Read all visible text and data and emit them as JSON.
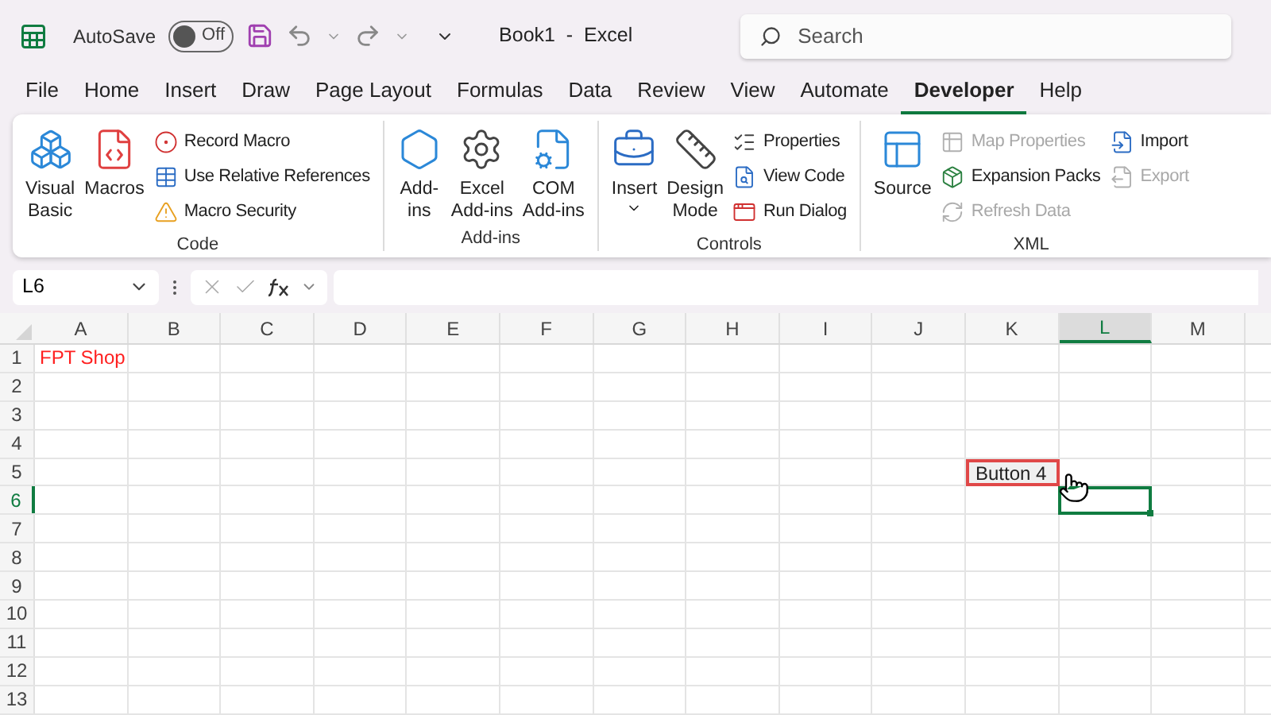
{
  "title_bar": {
    "autosave_label": "AutoSave",
    "autosave": {
      "on": false,
      "label": "Off"
    },
    "document_title": "Book1  -  Excel",
    "search": {
      "placeholder": "Search"
    }
  },
  "tabs": [
    {
      "label": "File",
      "selected": false
    },
    {
      "label": "Home",
      "selected": false
    },
    {
      "label": "Insert",
      "selected": false
    },
    {
      "label": "Draw",
      "selected": false
    },
    {
      "label": "Page Layout",
      "selected": false
    },
    {
      "label": "Formulas",
      "selected": false
    },
    {
      "label": "Data",
      "selected": false
    },
    {
      "label": "Review",
      "selected": false
    },
    {
      "label": "View",
      "selected": false
    },
    {
      "label": "Automate",
      "selected": false
    },
    {
      "label": "Developer",
      "selected": true
    },
    {
      "label": "Help",
      "selected": false
    }
  ],
  "ribbon": {
    "groups": [
      {
        "label": "Code",
        "items": [
          {
            "kind": "large",
            "lines": [
              "Visual",
              "Basic"
            ],
            "disabled": false
          },
          {
            "kind": "large",
            "lines": [
              "Macros"
            ],
            "disabled": false
          },
          {
            "kind": "small",
            "label": "Record Macro",
            "disabled": false
          },
          {
            "kind": "small",
            "label": "Use Relative References",
            "disabled": false
          },
          {
            "kind": "small",
            "label": "Macro Security",
            "disabled": false
          }
        ]
      },
      {
        "label": "Add-ins",
        "items": [
          {
            "kind": "large",
            "lines": [
              "Add-",
              "ins"
            ],
            "disabled": false
          },
          {
            "kind": "large",
            "lines": [
              "Excel",
              "Add-ins"
            ],
            "disabled": false
          },
          {
            "kind": "large",
            "lines": [
              "COM",
              "Add-ins"
            ],
            "disabled": false
          }
        ]
      },
      {
        "label": "Controls",
        "items": [
          {
            "kind": "large",
            "lines": [
              "Insert"
            ],
            "dropdown": true,
            "disabled": false
          },
          {
            "kind": "large",
            "lines": [
              "Design",
              "Mode"
            ],
            "disabled": false
          },
          {
            "kind": "small",
            "label": "Properties",
            "disabled": false
          },
          {
            "kind": "small",
            "label": "View Code",
            "disabled": false
          },
          {
            "kind": "small",
            "label": "Run Dialog",
            "disabled": false
          }
        ]
      },
      {
        "label": "XML",
        "items": [
          {
            "kind": "large",
            "lines": [
              "Source"
            ],
            "disabled": false
          },
          {
            "kind": "small",
            "label": "Map Properties",
            "disabled": true
          },
          {
            "kind": "small",
            "label": "Expansion Packs",
            "disabled": false
          },
          {
            "kind": "small",
            "label": "Refresh Data",
            "disabled": true
          },
          {
            "kind": "small",
            "label": "Import",
            "disabled": false
          },
          {
            "kind": "small",
            "label": "Export",
            "disabled": true
          }
        ]
      }
    ]
  },
  "formula_bar": {
    "name_box": "L6"
  },
  "sheet": {
    "columns": [
      {
        "label": "A",
        "selected": false
      },
      {
        "label": "B",
        "selected": false
      },
      {
        "label": "C",
        "selected": false
      },
      {
        "label": "D",
        "selected": false
      },
      {
        "label": "E",
        "selected": false
      },
      {
        "label": "F",
        "selected": false
      },
      {
        "label": "G",
        "selected": false
      },
      {
        "label": "H",
        "selected": false
      },
      {
        "label": "I",
        "selected": false
      },
      {
        "label": "J",
        "selected": false
      },
      {
        "label": "K",
        "selected": false
      },
      {
        "label": "L",
        "selected": true
      },
      {
        "label": "M",
        "selected": false
      }
    ],
    "rows": [
      {
        "label": "1",
        "selected": false,
        "cells": [
          {
            "text": "FPT Shop",
            "color": "#ff2020"
          }
        ]
      },
      {
        "label": "2",
        "selected": false
      },
      {
        "label": "3",
        "selected": false
      },
      {
        "label": "4",
        "selected": false
      },
      {
        "label": "5",
        "selected": false,
        "form_button": {
          "label": "Button 4",
          "selected": true
        }
      },
      {
        "label": "6",
        "selected": true
      },
      {
        "label": "7",
        "selected": false
      },
      {
        "label": "8",
        "selected": false
      },
      {
        "label": "9",
        "selected": false
      },
      {
        "label": "10",
        "selected": false
      },
      {
        "label": "11",
        "selected": false
      },
      {
        "label": "12",
        "selected": false
      },
      {
        "label": "13",
        "selected": false
      }
    ]
  }
}
